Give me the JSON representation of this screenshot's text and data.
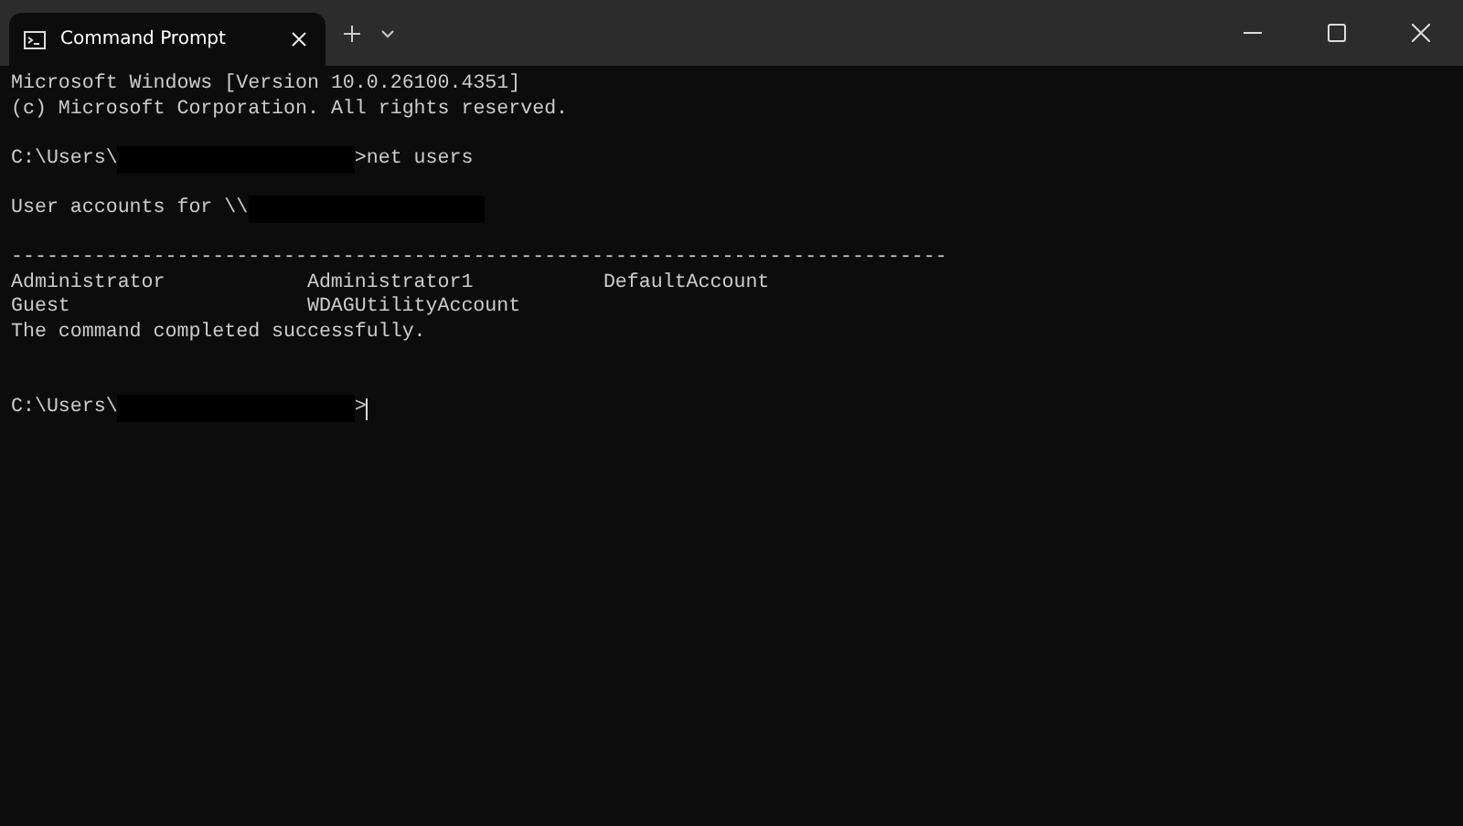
{
  "window": {
    "tab": {
      "title": "Command Prompt",
      "selected": true
    }
  },
  "terminal": {
    "lines": [
      {
        "kind": "text",
        "parts": [
          {
            "kind": "text",
            "text": "Microsoft Windows [Version 10.0.26100.4351]"
          }
        ]
      },
      {
        "kind": "text",
        "parts": [
          {
            "kind": "text",
            "text": "(c) Microsoft Corporation. All rights reserved."
          }
        ]
      },
      {
        "kind": "blank"
      },
      {
        "kind": "text",
        "parts": [
          {
            "kind": "text",
            "text": "C:\\Users\\"
          },
          {
            "kind": "redacted"
          },
          {
            "kind": "text",
            "text": ">net users"
          }
        ]
      },
      {
        "kind": "blank"
      },
      {
        "kind": "text",
        "parts": [
          {
            "kind": "text",
            "text": "User accounts for \\\\"
          },
          {
            "kind": "redacted"
          }
        ]
      },
      {
        "kind": "blank"
      },
      {
        "kind": "text",
        "parts": [
          {
            "kind": "text",
            "text": "-------------------------------------------------------------------------------"
          }
        ]
      },
      {
        "kind": "columns",
        "cells": [
          "Administrator",
          "Administrator1",
          "DefaultAccount"
        ]
      },
      {
        "kind": "columns",
        "cells": [
          "Guest",
          "WDAGUtilityAccount"
        ]
      },
      {
        "kind": "text",
        "parts": [
          {
            "kind": "text",
            "text": "The command completed successfully."
          }
        ]
      },
      {
        "kind": "blank"
      },
      {
        "kind": "blank"
      },
      {
        "kind": "text",
        "parts": [
          {
            "kind": "text",
            "text": "C:\\Users\\"
          },
          {
            "kind": "redacted"
          },
          {
            "kind": "text",
            "text": ">"
          },
          {
            "kind": "cursor"
          }
        ]
      }
    ]
  }
}
